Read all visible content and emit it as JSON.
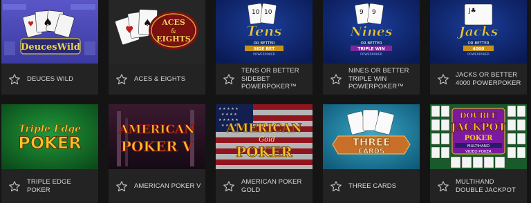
{
  "games": [
    {
      "title": "DEUCES WILD",
      "logo_text": "DeucesWild",
      "icon": "deuces-wild-artwork"
    },
    {
      "title": "ACES & EIGHTS",
      "logo_text": "ACES & EIGHTS",
      "icon": "aces-eights-artwork"
    },
    {
      "title": "TENS OR BETTER SIDEBET POWERPOKER™",
      "logo_text": "Tens",
      "icon": "tens-artwork"
    },
    {
      "title": "NINES OR BETTER TRIPLE WIN POWERPOKER™",
      "logo_text": "Nines",
      "icon": "nines-artwork"
    },
    {
      "title": "JACKS OR BETTER 4000 POWERPOKER",
      "logo_text": "Jacks",
      "icon": "jacks-artwork"
    },
    {
      "title": "TRIPLE EDGE POKER",
      "logo_text": "Triple Edge POKER",
      "icon": "triple-edge-artwork"
    },
    {
      "title": "AMERICAN POKER V",
      "logo_text": "AMERICAN POKER V",
      "icon": "american-poker-v-artwork"
    },
    {
      "title": "AMERICAN POKER GOLD",
      "logo_text": "AMERICAN Gold POKER",
      "icon": "american-poker-gold-artwork"
    },
    {
      "title": "THREE CARDS",
      "logo_text": "THREE CARDS",
      "icon": "three-cards-artwork"
    },
    {
      "title": "MULTIHAND DOUBLE JACKPOT",
      "logo_text": "DOUBLE JACKPOT POKER",
      "icon": "multihand-double-jackpot-artwork"
    }
  ],
  "icons": {
    "favorite": "star-outline-icon"
  },
  "colors": {
    "page_bg": "#141414",
    "card_bg": "#242424",
    "title_text": "#d9d9d9",
    "star": "#bdbdbd"
  }
}
